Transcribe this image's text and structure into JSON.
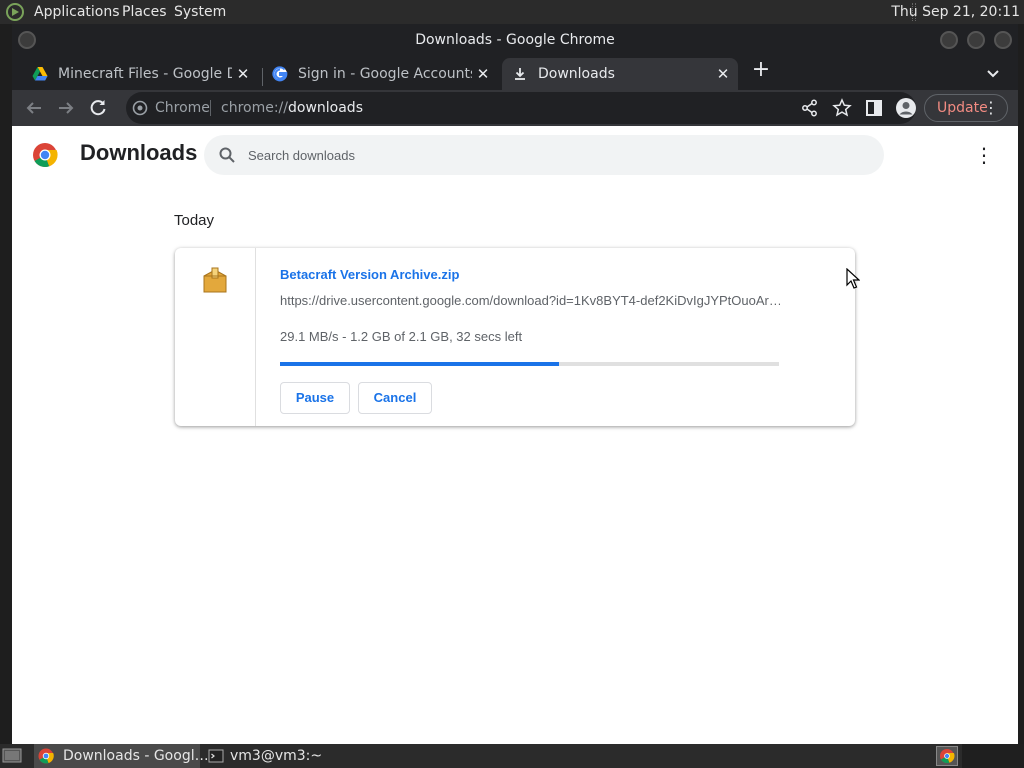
{
  "top_panel": {
    "menus": [
      "Applications",
      "Places",
      "System"
    ],
    "clock": "Thu Sep 21, 20:11"
  },
  "window": {
    "title": "Downloads - Google Chrome"
  },
  "tabs": [
    {
      "title": "Minecraft Files - Google Drive",
      "icon": "google-drive-icon",
      "active": false
    },
    {
      "title": "Sign in - Google Accounts",
      "icon": "google-g-icon",
      "active": false
    },
    {
      "title": "Downloads",
      "icon": "download-icon",
      "active": true
    }
  ],
  "toolbar": {
    "chip_label": "Chrome",
    "url_scheme": "chrome://",
    "url_host": "downloads",
    "update_label": "Update"
  },
  "downloads_page": {
    "title": "Downloads",
    "search_placeholder": "Search downloads",
    "section_label": "Today",
    "item": {
      "file_name": "Betacraft Version Archive.zip",
      "url": "https://drive.usercontent.google.com/download?id=1Kv8BYT4-def2KiDvIgJYPtOuoAr…",
      "status": "29.1 MB/s - 1.2 GB of 2.1 GB, 32 secs left",
      "progress_fraction": 0.56,
      "pause_label": "Pause",
      "cancel_label": "Cancel"
    }
  },
  "taskbar": {
    "items": [
      {
        "label": "Downloads - Googl…",
        "icon": "chrome-icon",
        "active": true
      },
      {
        "label": "vm3@vm3:~",
        "icon": "terminal-icon",
        "active": false
      }
    ]
  },
  "colors": {
    "accent": "#1a73e8",
    "update": "#f28b82",
    "toolbar_bg": "#35363a",
    "tabstrip_bg": "#202124"
  }
}
